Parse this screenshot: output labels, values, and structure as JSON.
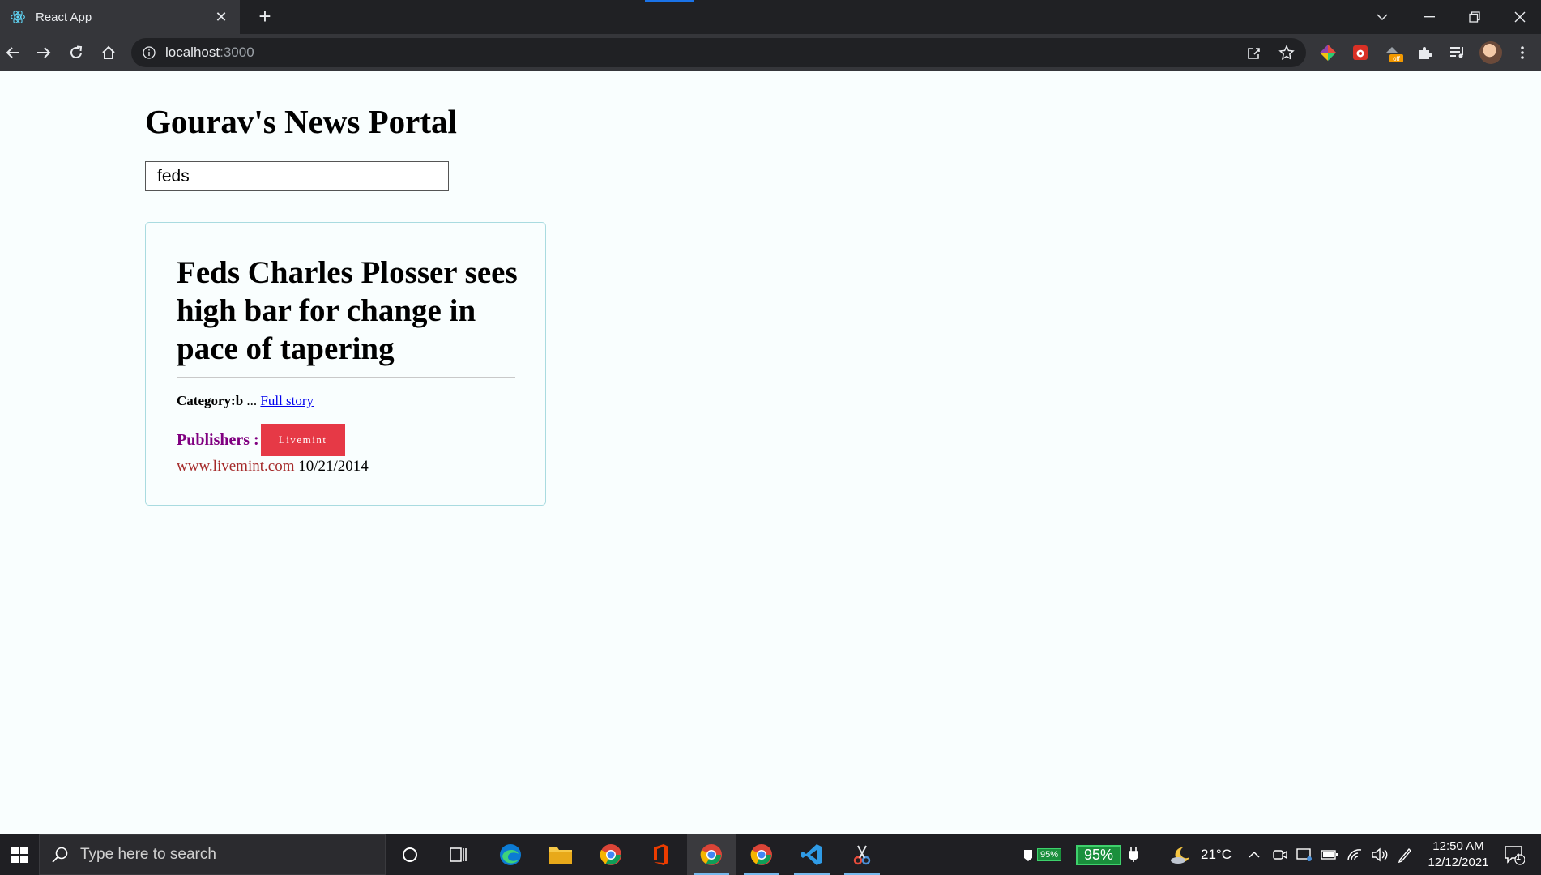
{
  "browser": {
    "tab_title": "React App",
    "tab_close": "✕",
    "new_tab": "+",
    "url_host": "localhost",
    "url_port": ":3000"
  },
  "page": {
    "portal_title": "Gourav's News Portal",
    "search_value": "feds"
  },
  "article": {
    "title": "Feds Charles Plosser sees high bar for change in pace of tapering",
    "category_text": "Category:b",
    "ellipsis": " ... ",
    "full_story_link": "Full story",
    "publishers_label": "Publishers :",
    "publisher_badge": "Livemint",
    "source_domain": "www.livemint.com",
    "date": " 10/21/2014"
  },
  "taskbar": {
    "search_placeholder": "Type here to search",
    "battery_small": "95%",
    "battery_large": "95%",
    "temperature": "21°C",
    "time": "12:50 AM",
    "date": "12/12/2021",
    "notification_count": "1"
  },
  "colors": {
    "chrome_dark": "#202124",
    "chrome_toolbar": "#35363a",
    "page_bg": "#f9fefe",
    "card_border": "#a9dbe0",
    "publisher_badge": "#e63946",
    "publishers_label": "#800080",
    "source_domain": "#a52a2a",
    "link": "#0000ee",
    "taskbar": "#1f1f23"
  }
}
